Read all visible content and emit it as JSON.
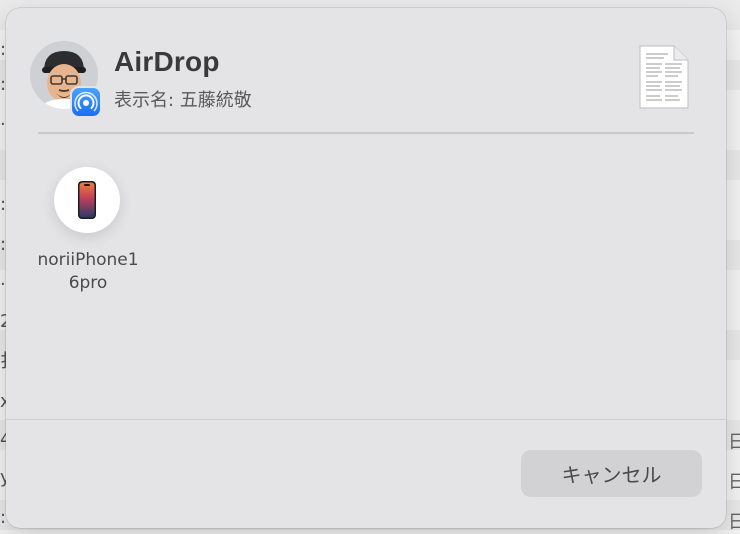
{
  "dialog": {
    "title": "AirDrop",
    "subtitle": "表示名: 五藤統敬",
    "avatar_icon": "memoji-avatar",
    "badge_icon": "airdrop-icon",
    "document_icon": "text-document-icon",
    "devices": [
      {
        "label": "noriiPhone16pro",
        "icon": "iphone-icon"
      }
    ],
    "cancel_label": "キャンセル"
  },
  "background": {
    "right_fragments": [
      "日",
      "日",
      "日"
    ]
  },
  "colors": {
    "dialog_bg": "#e4e4e6",
    "button_bg": "#d2d2d5",
    "airdrop_blue": "#1b6ff2"
  }
}
